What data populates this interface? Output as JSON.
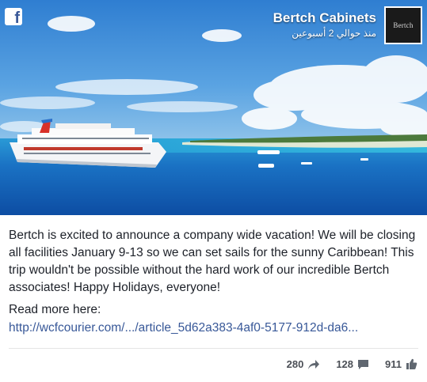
{
  "page": {
    "name": "Bertch Cabinets",
    "time": "منذ حوالي 2 أسبوعين",
    "avatar_text": "Bertch"
  },
  "post": {
    "text": "Bertch is excited to announce a company wide vacation! We will be closing all facilities January 9-13 so we can set sails for the sunny Caribbean! This trip wouldn't be possible without the hard work of our incredible Bertch associates! Happy Holidays, everyone!",
    "read_more_label": "Read more here:",
    "link": "http://wcfcourier.com/.../article_5d62a383-4af0-5177-912d-da6..."
  },
  "stats": {
    "shares": "280",
    "comments": "128",
    "likes": "911"
  },
  "icons": {
    "logo": "facebook-icon",
    "share": "share-arrow-icon",
    "comment": "comment-icon",
    "like": "thumbs-up-icon"
  },
  "colors": {
    "link": "#385898",
    "text": "#1d2129",
    "meta": "#4b4f56",
    "sea": "#1560b8",
    "sky": "#3f8fd6"
  }
}
